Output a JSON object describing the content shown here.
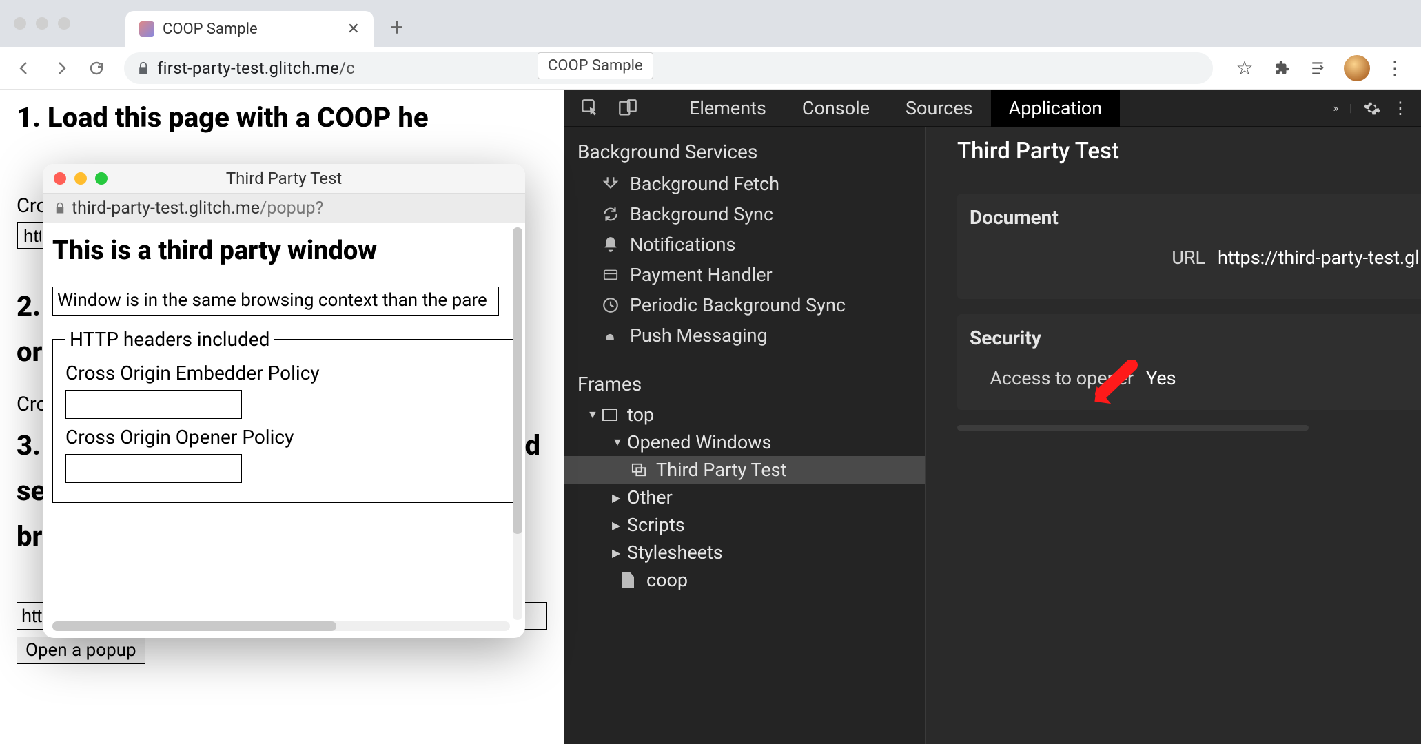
{
  "browser": {
    "tab_title": "COOP Sample",
    "new_tab_glyph": "+",
    "close_glyph": "✕",
    "url_prefix": "first-party-test.glitch.me",
    "url_path": "/c",
    "page_title_badge": "COOP Sample",
    "actions": {
      "star": "☆",
      "ext": "✦",
      "menu": "⋮",
      "equalizer": "≡"
    }
  },
  "page": {
    "h1": "1. Load this page with a COOP he",
    "label_cro_trunc": "Cro",
    "input_http_trunc": "http",
    "h2": "2.",
    "or": "or",
    "h3_a": "3.",
    "h3_b": "d",
    "h3_c": "se",
    "h3_d": "br",
    "url_input_value": "https://third-party-test.glitch.me/popup?",
    "open_popup_btn": "Open a popup"
  },
  "popup": {
    "title": "Third Party Test",
    "url_host": "third-party-test.glitch.me",
    "url_path": "/popup?",
    "heading": "This is a third party window",
    "status_text": "Window is in the same browsing context than the pare",
    "legend": "HTTP headers included",
    "coep_label": "Cross Origin Embedder Policy",
    "coop_label": "Cross Origin Opener Policy",
    "coep_value": "",
    "coop_value": ""
  },
  "devtools": {
    "tabs": {
      "elements": "Elements",
      "console": "Console",
      "sources": "Sources",
      "application": "Application"
    },
    "more": "»",
    "tree": {
      "background_services": "Background Services",
      "items": [
        "Background Fetch",
        "Background Sync",
        "Notifications",
        "Payment Handler",
        "Periodic Background Sync",
        "Push Messaging"
      ],
      "frames": "Frames",
      "top": "top",
      "opened_windows": "Opened Windows",
      "third_party_test": "Third Party Test",
      "other": "Other",
      "scripts": "Scripts",
      "stylesheets": "Stylesheets",
      "coop_file": "coop"
    },
    "detail": {
      "title": "Third Party Test",
      "document_heading": "Document",
      "url_key": "URL",
      "url_value": "https://third-party-test.gl",
      "security_heading": "Security",
      "opener_key": "Access to opener",
      "opener_value": "Yes"
    }
  }
}
